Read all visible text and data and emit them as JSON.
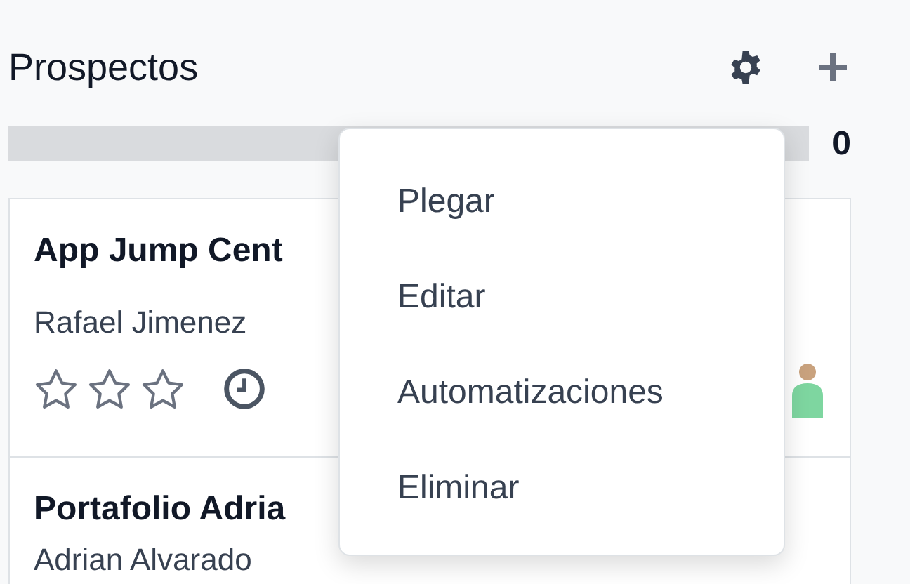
{
  "column": {
    "title": "Prospectos",
    "progress": {
      "level": 0,
      "count": "0"
    }
  },
  "cards": [
    {
      "title": "App Jump Cent",
      "contact": "Rafael Jimenez",
      "stars": 0
    },
    {
      "title": "Portafolio Adria",
      "contact": "Adrian Alvarado"
    }
  ],
  "menu": {
    "items": [
      {
        "label": "Plegar"
      },
      {
        "label": "Editar"
      },
      {
        "label": "Automatizaciones"
      },
      {
        "label": "Eliminar"
      }
    ]
  }
}
